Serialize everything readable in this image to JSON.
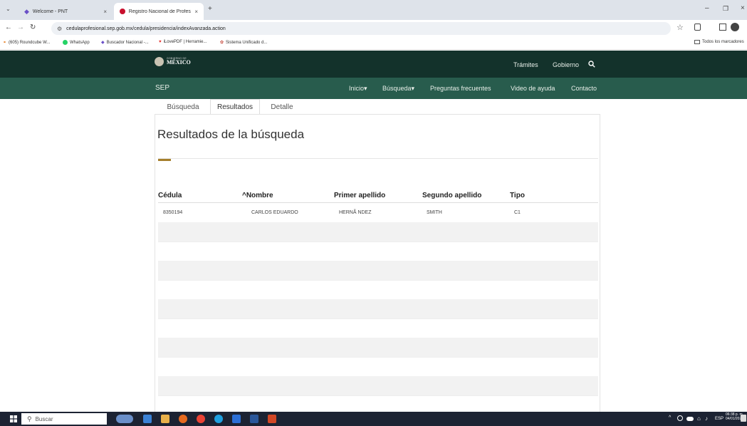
{
  "browser": {
    "tabs": [
      {
        "title": "Welcome - PNT",
        "close": "×"
      },
      {
        "title": "Registro Nacional de Profesion",
        "close": "×"
      }
    ],
    "new_tab": "+",
    "url": "cedulaprofesional.sep.gob.mx/cedula/presidencia/indexAvanzada.action",
    "bookmarks": [
      "(605) Roundcube W...",
      "WhatsApp",
      "Buscador Nacional -...",
      "iLovePDF | Herramie...",
      "Sistema Unificado d..."
    ],
    "all_bookmarks": "Todos los marcadores",
    "window_controls": {
      "minimize": "–",
      "restore": "❐",
      "close": "×"
    }
  },
  "site": {
    "logo_top": "GOBIERNO DE",
    "logo_main": "MÉXICO",
    "gob_nav": [
      "Trámites",
      "Gobierno"
    ],
    "brand": "SEP",
    "main_nav": [
      "Inicio▾",
      "Búsqueda▾",
      "Preguntas frecuentes",
      "Video de ayuda",
      "Contacto"
    ]
  },
  "page": {
    "tabs": [
      "Búsqueda",
      "Resultados",
      "Detalle"
    ],
    "heading": "Resultados de la búsqueda",
    "columns": [
      "Cédula",
      "^Nombre",
      "Primer apellido",
      "Segundo apellido",
      "Tipo"
    ],
    "rows": [
      [
        "8350194",
        "CARLOS EDUARDO",
        "HERNÃ NDEZ",
        "SMITH",
        "C1"
      ]
    ]
  },
  "taskbar": {
    "search": "Buscar",
    "lang": "ESP",
    "time": "06:38 p. m.",
    "date": "04/01/2024"
  },
  "colors": {
    "gob_dark": "#13322b",
    "sep_green": "#285c4d",
    "accent_gold": "#a57f2c"
  }
}
